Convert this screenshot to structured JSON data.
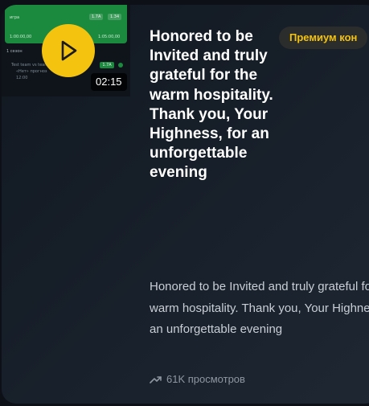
{
  "video": {
    "duration": "02:15",
    "thumbnail": {
      "rows": [
        "игра",
        "1:00:00,00",
        "1:05:00,00",
        "1 сезон",
        "Test team vs team",
        "12:00",
        "«Нет» прогноз",
        "1.7A",
        "1.34"
      ]
    }
  },
  "badge": {
    "label": "Премиум кон"
  },
  "post": {
    "title": "Honored to be Invited and truly grateful for the warm hospitality. Thank you, Your Highness, for an unforgettable evening",
    "description": "Honored to be Invited and truly grateful for the warm hospitality. Thank you, Your Highness, for an unforgettable evening",
    "views": "61K просмотров"
  },
  "colors": {
    "accent": "#f4c30f",
    "card_bg": "#151c25",
    "title": "#ffffff",
    "muted": "#8d96a1"
  },
  "icons": {
    "play": "play-icon",
    "views": "trending-up-icon"
  }
}
